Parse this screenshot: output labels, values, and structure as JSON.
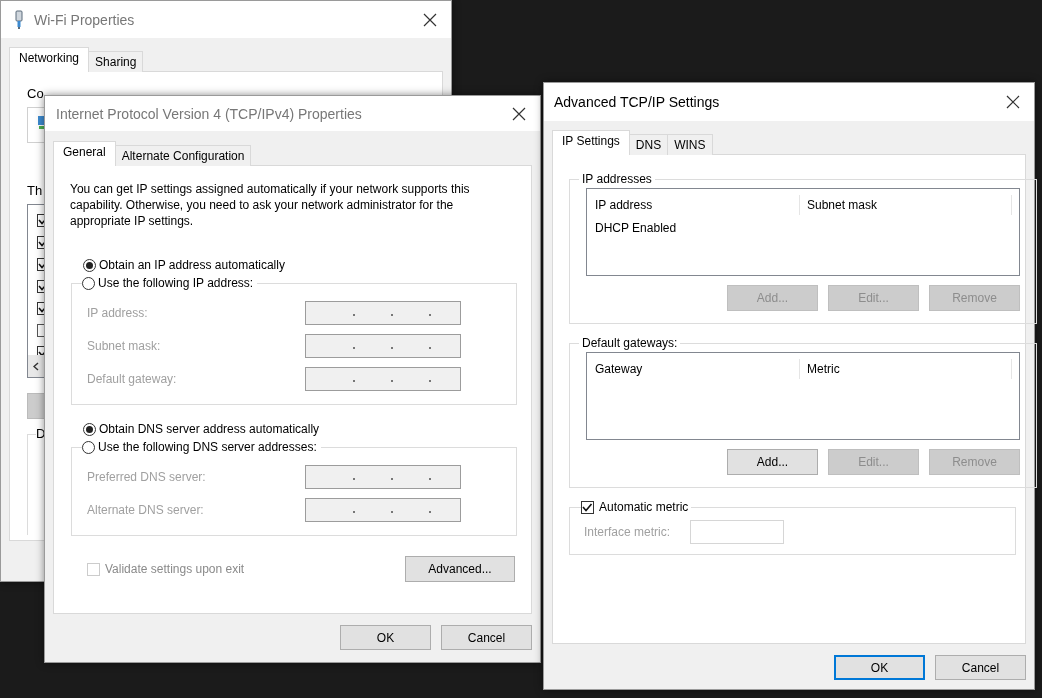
{
  "wifi": {
    "title": "Wi-Fi Properties",
    "tabs": [
      {
        "label": "Networking",
        "selected": true
      },
      {
        "label": "Sharing",
        "selected": false
      }
    ],
    "connect_label": "Co",
    "components_label": "Th",
    "components": [
      {
        "checked": true
      },
      {
        "checked": true
      },
      {
        "checked": true
      },
      {
        "checked": true
      },
      {
        "checked": true
      },
      {
        "checked": false
      },
      {
        "checked": true
      }
    ],
    "description_label": "D"
  },
  "ipv4": {
    "title": "Internet Protocol Version 4 (TCP/IPv4) Properties",
    "tabs": [
      {
        "label": "General",
        "selected": true
      },
      {
        "label": "Alternate Configuration",
        "selected": false
      }
    ],
    "intro": "You can get IP settings assigned automatically if your network supports this capability. Otherwise, you need to ask your network administrator for the appropriate IP settings.",
    "ip_options": [
      {
        "label": "Obtain an IP address automatically",
        "selected": true
      },
      {
        "label": "Use the following IP address:",
        "selected": false
      }
    ],
    "ip_fields": [
      {
        "label": "IP address:",
        "disabled": true
      },
      {
        "label": "Subnet mask:",
        "disabled": true
      },
      {
        "label": "Default gateway:",
        "disabled": true
      }
    ],
    "dns_options": [
      {
        "label": "Obtain DNS server address automatically",
        "selected": true
      },
      {
        "label": "Use the following DNS server addresses:",
        "selected": false
      }
    ],
    "dns_fields": [
      {
        "label": "Preferred DNS server:",
        "disabled": true
      },
      {
        "label": "Alternate DNS server:",
        "disabled": true
      }
    ],
    "validate": {
      "label": "Validate settings upon exit",
      "checked": false,
      "disabled": true
    },
    "advanced_button": "Advanced...",
    "buttons": [
      {
        "label": "OK",
        "default": false
      },
      {
        "label": "Cancel",
        "default": false
      }
    ]
  },
  "advanced": {
    "title": "Advanced TCP/IP Settings",
    "tabs": [
      {
        "label": "IP Settings",
        "selected": true
      },
      {
        "label": "DNS",
        "selected": false
      },
      {
        "label": "WINS",
        "selected": false
      }
    ],
    "groups": [
      {
        "label": "IP addresses",
        "columns": [
          "IP address",
          "Subnet mask"
        ],
        "rows": [
          [
            "DHCP Enabled"
          ]
        ],
        "buttons": [
          {
            "label": "Add...",
            "disabled": true
          },
          {
            "label": "Edit...",
            "disabled": true
          },
          {
            "label": "Remove",
            "disabled": true
          }
        ]
      },
      {
        "label": "Default gateways:",
        "columns": [
          "Gateway",
          "Metric"
        ],
        "buttons": [
          {
            "label": "Add...",
            "disabled": false
          },
          {
            "label": "Edit...",
            "disabled": true
          },
          {
            "label": "Remove",
            "disabled": true
          }
        ]
      }
    ],
    "automatic_metric": {
      "label": "Automatic metric",
      "checked": true
    },
    "interface_metric": {
      "label": "Interface metric:",
      "disabled": true
    },
    "buttons": [
      {
        "label": "OK",
        "default": true
      },
      {
        "label": "Cancel",
        "default": false
      }
    ]
  }
}
